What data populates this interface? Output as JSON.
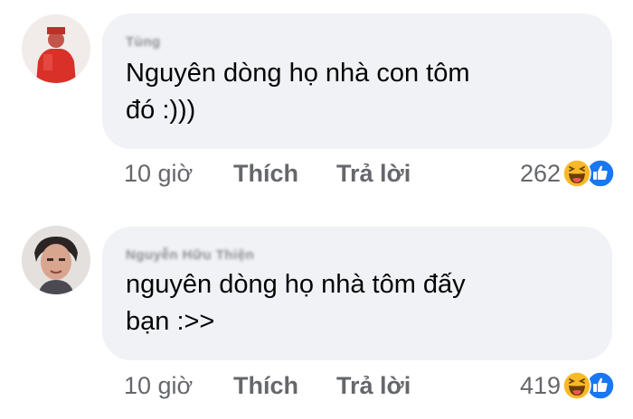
{
  "comments": [
    {
      "author": "Tùng",
      "text_line1": "Nguyên dòng họ nhà con tôm",
      "text_line2": "đó :)))",
      "time": "10 giờ",
      "like_label": "Thích",
      "reply_label": "Trả lời",
      "reaction_count": "262",
      "reactions": [
        "haha-icon",
        "like-icon"
      ]
    },
    {
      "author": "Nguyễn Hữu Thiện",
      "text_line1": "nguyên dòng họ nhà tôm đấy",
      "text_line2": "bạn :>>",
      "time": "10 giờ",
      "like_label": "Thích",
      "reply_label": "Trả lời",
      "reaction_count": "419",
      "reactions": [
        "haha-icon",
        "like-icon"
      ]
    }
  ],
  "colors": {
    "bubble": "#f0f2f5",
    "meta_text": "#65676b",
    "like_blue": "#1877f2",
    "haha_yellow": "#f7b928"
  }
}
